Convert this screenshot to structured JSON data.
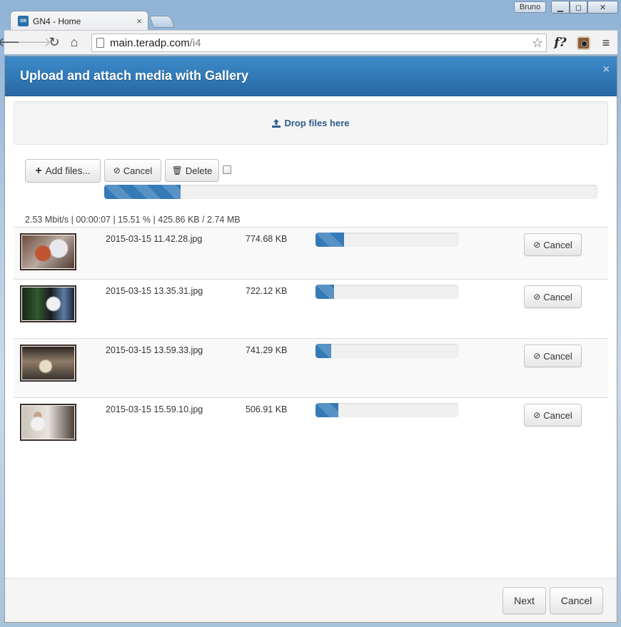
{
  "browser": {
    "tab_title": "GN4 - Home",
    "tab_favicon": "GN",
    "tab_close": "×",
    "user": "Bruno",
    "url_host": "main.teradp.com",
    "url_path": "/i4",
    "ext_label": "f?"
  },
  "modal": {
    "title": "Upload and attach media with Gallery",
    "close": "×",
    "dropzone_label": "Drop files here",
    "add_files_label": "Add files...",
    "cancel_label": "Cancel",
    "delete_label": "Delete",
    "global_progress": 0.1551,
    "stats": "2.53 Mbit/s | 00:00:07 | 15.51 % | 425.86 KB / 2.74 MB",
    "files": [
      {
        "name": "2015-03-15 11.42.28.jpg",
        "size": "774.68 KB",
        "progress": 0.2,
        "cancel": "Cancel"
      },
      {
        "name": "2015-03-15 13.35.31.jpg",
        "size": "722.12 KB",
        "progress": 0.13,
        "cancel": "Cancel"
      },
      {
        "name": "2015-03-15 13.59.33.jpg",
        "size": "741.29 KB",
        "progress": 0.11,
        "cancel": "Cancel"
      },
      {
        "name": "2015-03-15 15.59.10.jpg",
        "size": "506.91 KB",
        "progress": 0.16,
        "cancel": "Cancel"
      }
    ],
    "next_label": "Next",
    "footer_cancel_label": "Cancel"
  },
  "colors": {
    "header": "#2f77b8",
    "progress": "#337ab7"
  }
}
